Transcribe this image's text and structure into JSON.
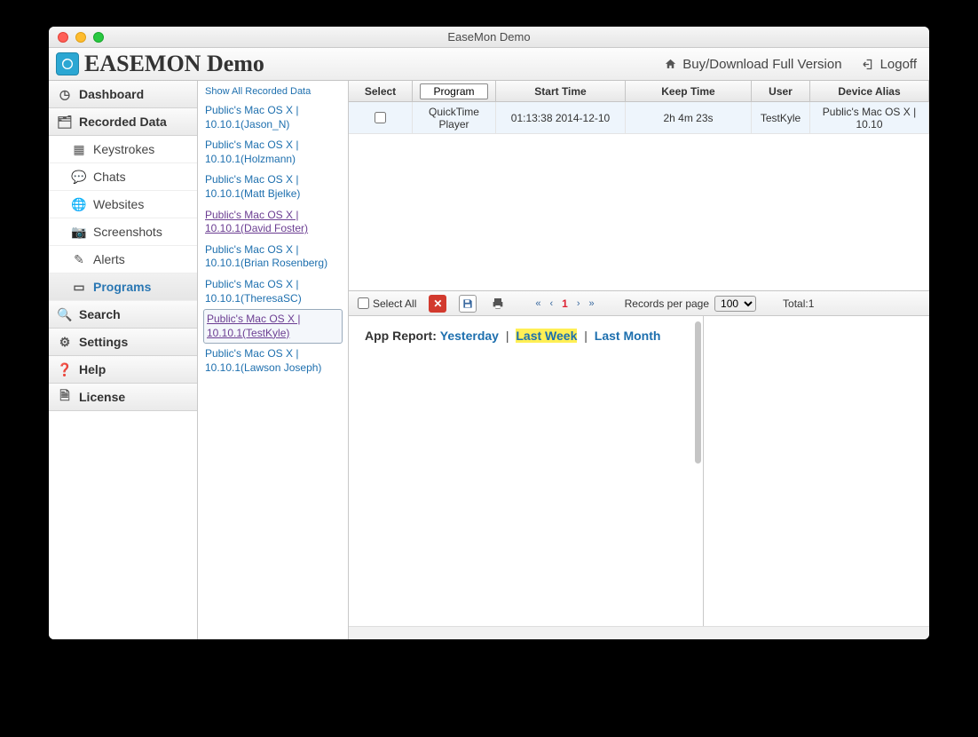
{
  "titlebar": {
    "title": "EaseMon Demo"
  },
  "header": {
    "app_title": "EASEMON Demo",
    "buy_label": "Buy/Download Full Version",
    "logoff_label": "Logoff"
  },
  "sidebar": {
    "items": [
      {
        "label": "Dashboard",
        "kind": "section"
      },
      {
        "label": "Recorded Data",
        "kind": "section"
      },
      {
        "label": "Keystrokes",
        "kind": "sub"
      },
      {
        "label": "Chats",
        "kind": "sub"
      },
      {
        "label": "Websites",
        "kind": "sub"
      },
      {
        "label": "Screenshots",
        "kind": "sub"
      },
      {
        "label": "Alerts",
        "kind": "sub"
      },
      {
        "label": "Programs",
        "kind": "sub",
        "active": true
      },
      {
        "label": "Search",
        "kind": "section"
      },
      {
        "label": "Settings",
        "kind": "section"
      },
      {
        "label": "Help",
        "kind": "section"
      },
      {
        "label": "License",
        "kind": "section"
      }
    ]
  },
  "devices": {
    "top_truncated": "Show All Recorded Data",
    "list": [
      {
        "label": "Public's Mac OS X | 10.10.1(Jason_N)"
      },
      {
        "label": "Public's Mac OS X | 10.10.1(Holzmann)"
      },
      {
        "label": "Public's Mac OS X | 10.10.1(Matt Bjelke)"
      },
      {
        "label": "Public's Mac OS X | 10.10.1(David Foster)",
        "visited": true
      },
      {
        "label": "Public's Mac OS X | 10.10.1(Brian Rosenberg)"
      },
      {
        "label": "Public's Mac OS X | 10.10.1(TheresaSC)"
      },
      {
        "label": "Public's Mac OS X | 10.10.1(TestKyle)",
        "selected": true,
        "visited": true
      },
      {
        "label": "Public's Mac OS X | 10.10.1(Lawson Joseph)"
      }
    ]
  },
  "grid": {
    "columns": {
      "select": "Select",
      "program": "Program",
      "start": "Start Time",
      "keep": "Keep Time",
      "user": "User",
      "device": "Device Alias"
    },
    "rows": [
      {
        "program": "QuickTime Player",
        "start": "01:13:38 2014-12-10",
        "keep": "2h 4m 23s",
        "user": "TestKyle",
        "device": "Public's Mac OS X | 10.10"
      }
    ]
  },
  "footer": {
    "select_all": "Select All",
    "page_current": "1",
    "rpp_label": "Records per page",
    "rpp_value": "100",
    "total_label": "Total:1"
  },
  "report": {
    "label": "App Report:",
    "links": {
      "yesterday": "Yesterday",
      "last_week": "Last Week",
      "last_month": "Last Month"
    },
    "active": "last_week"
  }
}
